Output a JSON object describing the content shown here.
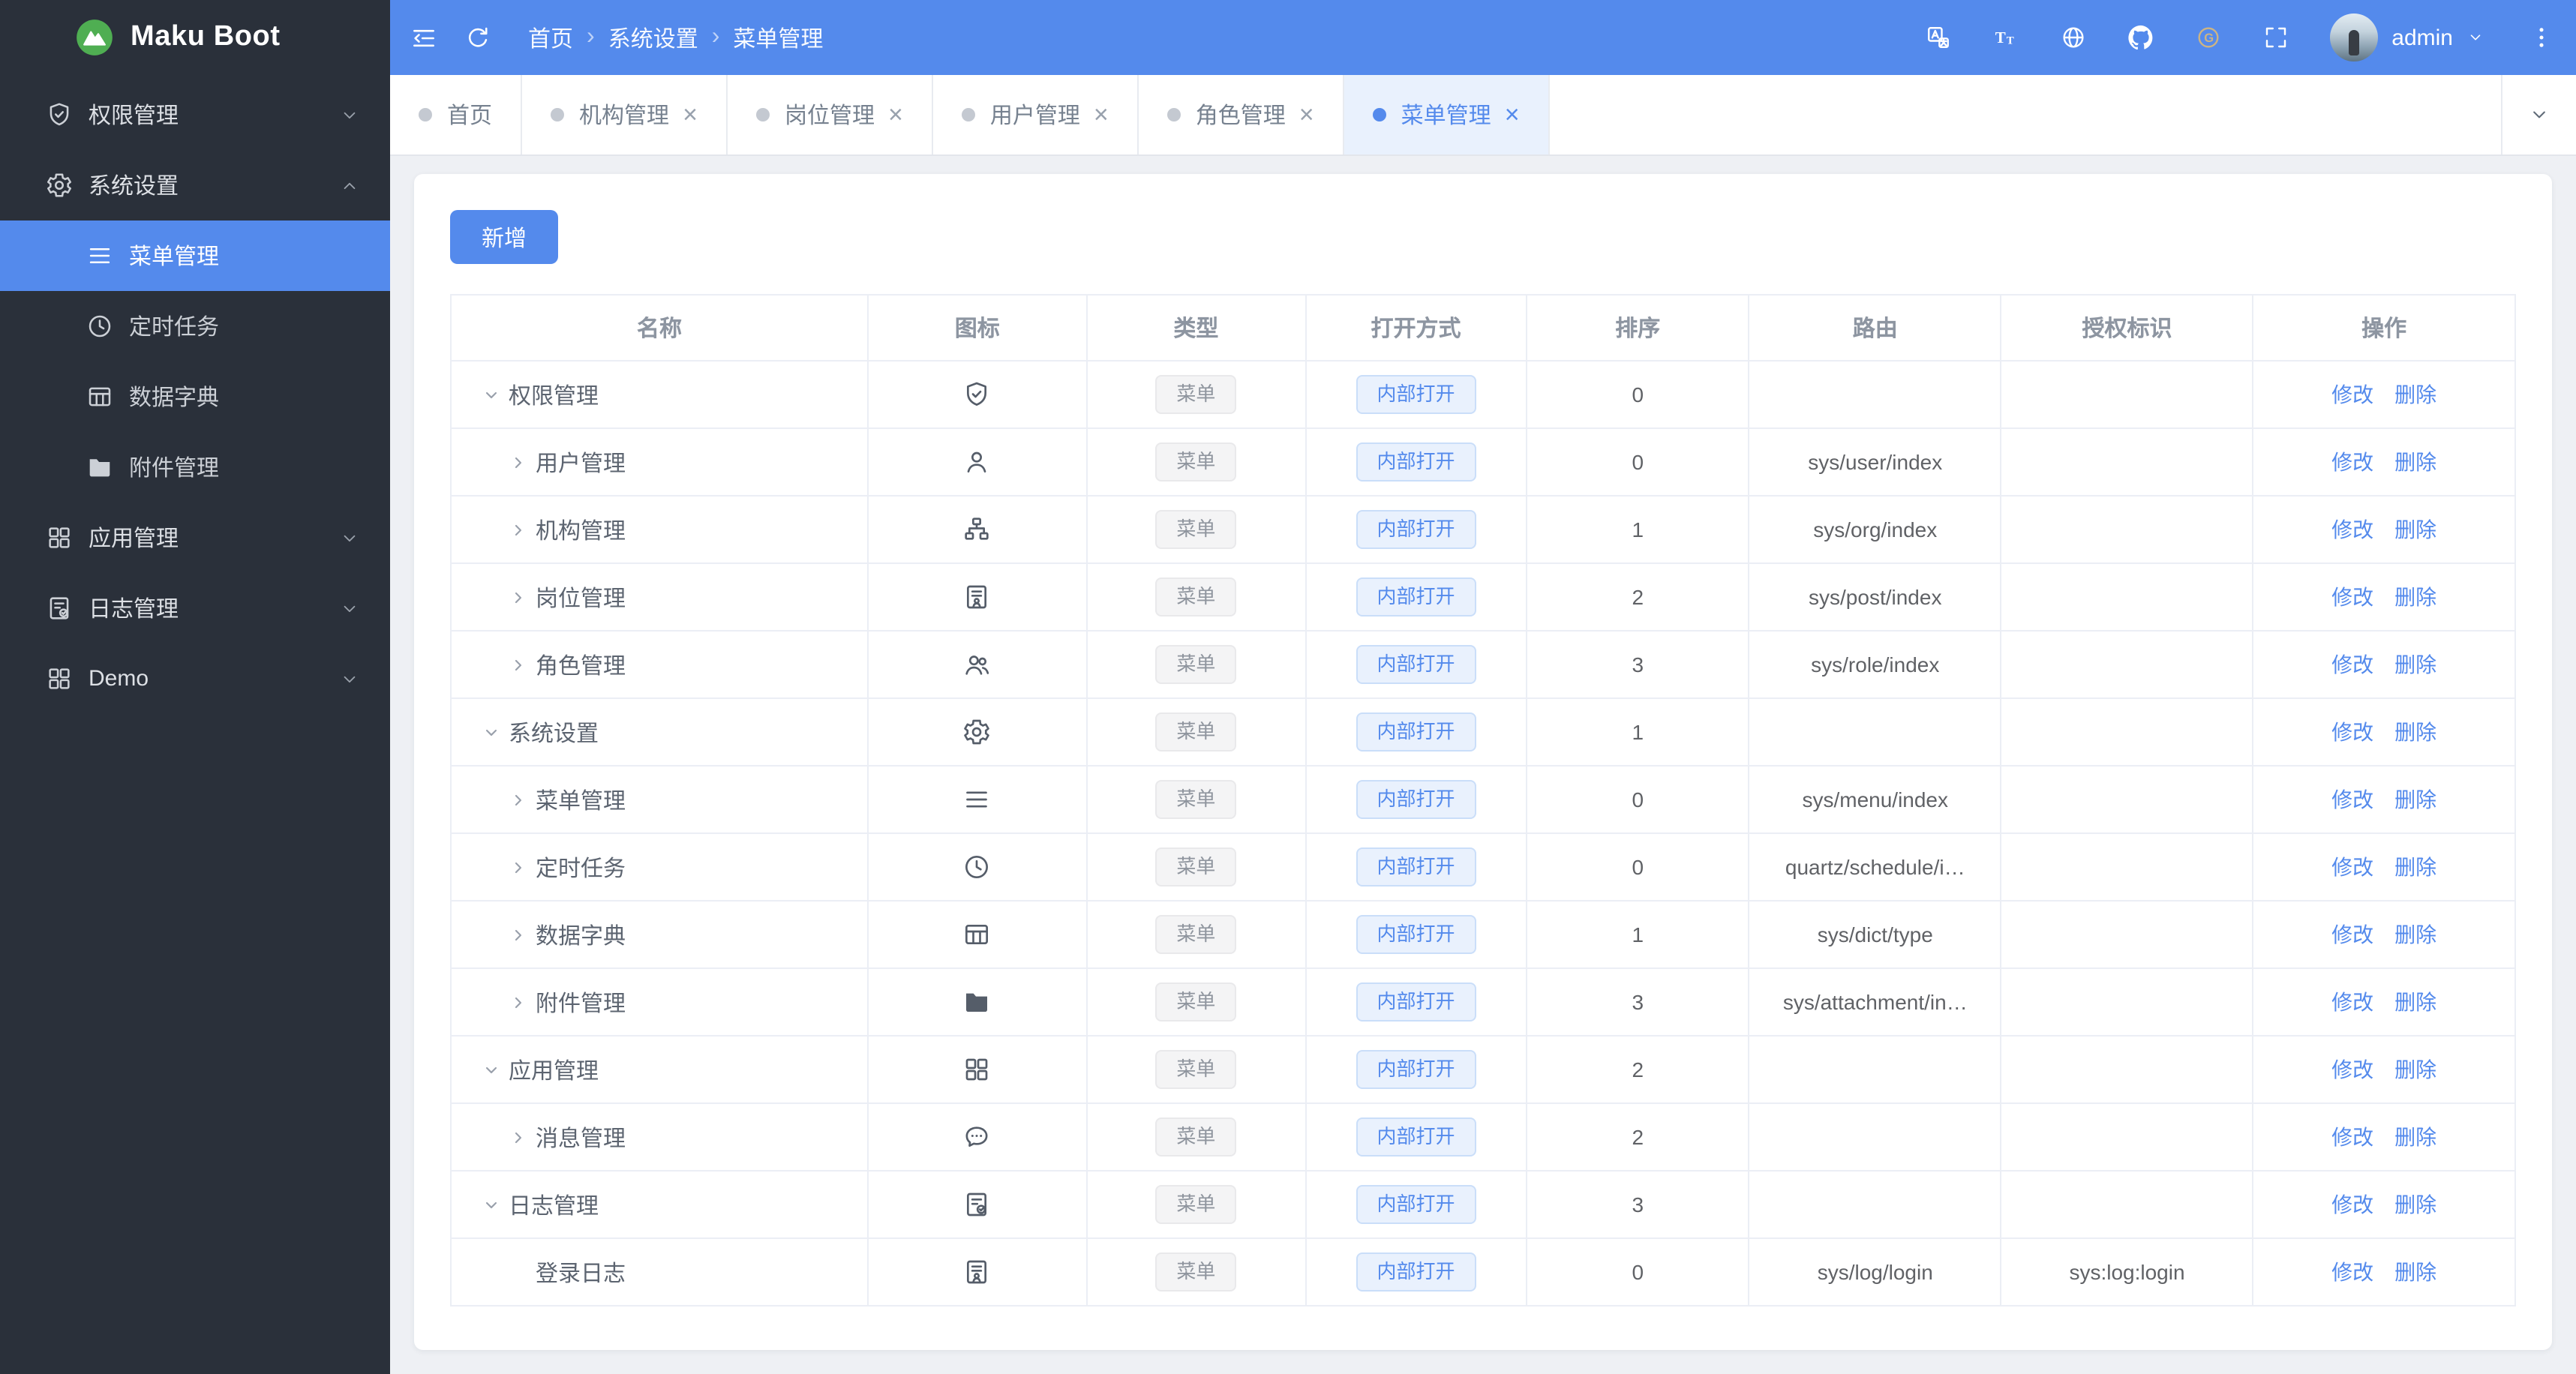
{
  "colors": {
    "primary": "#548aec",
    "sidebar_bg": "#2a303a",
    "page_bg": "#eef0f4",
    "logo_green": "#4fae52",
    "tag_info_bg": "#f4f4f5",
    "tag_info_text": "#8f959e",
    "tag_primary_bg": "#e9f1fd",
    "tag_primary_text": "#548aec",
    "active_tab_bg": "#e9f1fd"
  },
  "sidebar": {
    "logo_text": "Maku Boot",
    "logo_icon": "mountain-logo-icon",
    "items": [
      {
        "key": "perm",
        "label": "权限管理",
        "icon": "shield-check-icon",
        "state": "collapsed"
      },
      {
        "key": "system",
        "label": "系统设置",
        "icon": "gear-icon",
        "state": "expanded",
        "children": [
          {
            "key": "menu",
            "label": "菜单管理",
            "icon": "menu-icon",
            "active": true
          },
          {
            "key": "schedule",
            "label": "定时任务",
            "icon": "clock-icon"
          },
          {
            "key": "dict",
            "label": "数据字典",
            "icon": "dict-table-icon"
          },
          {
            "key": "attachment",
            "label": "附件管理",
            "icon": "folder-icon"
          }
        ]
      },
      {
        "key": "app",
        "label": "应用管理",
        "icon": "appgrid-icon",
        "state": "collapsed"
      },
      {
        "key": "log",
        "label": "日志管理",
        "icon": "log-doc-icon",
        "state": "collapsed"
      },
      {
        "key": "demo",
        "label": "Demo",
        "icon": "appgrid-icon",
        "state": "collapsed"
      }
    ]
  },
  "topbar": {
    "breadcrumb": [
      "首页",
      "系统设置",
      "菜单管理"
    ],
    "user_name": "admin",
    "right_icons": [
      {
        "key": "translate",
        "name": "translate-icon"
      },
      {
        "key": "font-size",
        "name": "font-size-icon"
      },
      {
        "key": "locale",
        "name": "globe-icon"
      },
      {
        "key": "github",
        "name": "github-icon"
      },
      {
        "key": "gitee",
        "name": "gitee-icon"
      },
      {
        "key": "fullscreen",
        "name": "fullscreen-icon"
      }
    ]
  },
  "tabs": {
    "items": [
      {
        "key": "home",
        "label": "首页",
        "closable": false,
        "active": false
      },
      {
        "key": "org",
        "label": "机构管理",
        "closable": true,
        "active": false
      },
      {
        "key": "post",
        "label": "岗位管理",
        "closable": true,
        "active": false
      },
      {
        "key": "user",
        "label": "用户管理",
        "closable": true,
        "active": false
      },
      {
        "key": "role",
        "label": "角色管理",
        "closable": true,
        "active": false
      },
      {
        "key": "menu",
        "label": "菜单管理",
        "closable": true,
        "active": true
      }
    ]
  },
  "toolbar": {
    "add_label": "新增"
  },
  "table": {
    "columns": [
      "名称",
      "图标",
      "类型",
      "打开方式",
      "排序",
      "路由",
      "授权标识",
      "操作"
    ],
    "action_labels": [
      "修改",
      "删除"
    ],
    "rows": [
      {
        "name": "权限管理",
        "level": 0,
        "expand": "down",
        "icon": "shield-check-icon",
        "type": "菜单",
        "open": "内部打开",
        "sort": "0",
        "route": "",
        "perm": ""
      },
      {
        "name": "用户管理",
        "level": 1,
        "expand": "right",
        "icon": "user-icon",
        "type": "菜单",
        "open": "内部打开",
        "sort": "0",
        "route": "sys/user/index",
        "perm": ""
      },
      {
        "name": "机构管理",
        "level": 1,
        "expand": "right",
        "icon": "org-tree-icon",
        "type": "菜单",
        "open": "内部打开",
        "sort": "1",
        "route": "sys/org/index",
        "perm": ""
      },
      {
        "name": "岗位管理",
        "level": 1,
        "expand": "right",
        "icon": "id-badge-icon",
        "type": "菜单",
        "open": "内部打开",
        "sort": "2",
        "route": "sys/post/index",
        "perm": ""
      },
      {
        "name": "角色管理",
        "level": 1,
        "expand": "right",
        "icon": "user-group-icon",
        "type": "菜单",
        "open": "内部打开",
        "sort": "3",
        "route": "sys/role/index",
        "perm": ""
      },
      {
        "name": "系统设置",
        "level": 0,
        "expand": "down",
        "icon": "gear-icon",
        "type": "菜单",
        "open": "内部打开",
        "sort": "1",
        "route": "",
        "perm": ""
      },
      {
        "name": "菜单管理",
        "level": 1,
        "expand": "right",
        "icon": "menu-icon",
        "type": "菜单",
        "open": "内部打开",
        "sort": "0",
        "route": "sys/menu/index",
        "perm": ""
      },
      {
        "name": "定时任务",
        "level": 1,
        "expand": "right",
        "icon": "clock-icon",
        "type": "菜单",
        "open": "内部打开",
        "sort": "0",
        "route": "quartz/schedule/i…",
        "perm": ""
      },
      {
        "name": "数据字典",
        "level": 1,
        "expand": "right",
        "icon": "dict-table-icon",
        "type": "菜单",
        "open": "内部打开",
        "sort": "1",
        "route": "sys/dict/type",
        "perm": ""
      },
      {
        "name": "附件管理",
        "level": 1,
        "expand": "right",
        "icon": "folder-icon",
        "type": "菜单",
        "open": "内部打开",
        "sort": "3",
        "route": "sys/attachment/in…",
        "perm": ""
      },
      {
        "name": "应用管理",
        "level": 0,
        "expand": "down",
        "icon": "appgrid-icon",
        "type": "菜单",
        "open": "内部打开",
        "sort": "2",
        "route": "",
        "perm": ""
      },
      {
        "name": "消息管理",
        "level": 1,
        "expand": "right",
        "icon": "message-icon",
        "type": "菜单",
        "open": "内部打开",
        "sort": "2",
        "route": "",
        "perm": ""
      },
      {
        "name": "日志管理",
        "level": 0,
        "expand": "down",
        "icon": "log-doc-icon",
        "type": "菜单",
        "open": "内部打开",
        "sort": "3",
        "route": "",
        "perm": ""
      },
      {
        "name": "登录日志",
        "level": 1,
        "expand": "none",
        "icon": "id-badge-icon",
        "type": "菜单",
        "open": "内部打开",
        "sort": "0",
        "route": "sys/log/login",
        "perm": "sys:log:login"
      }
    ]
  }
}
